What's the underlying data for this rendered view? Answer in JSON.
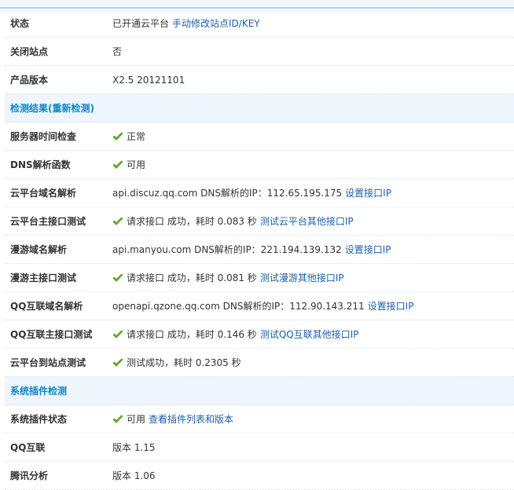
{
  "colors": {
    "link": "#1e5fa8",
    "section": "#0e86c6",
    "check": "#5cb82a"
  },
  "rows": [
    {
      "label": "状态",
      "parts": [
        {
          "t": "已开通云平台"
        },
        {
          "t": "手动修改站点ID/KEY",
          "link": true
        }
      ]
    },
    {
      "label": "关闭站点",
      "parts": [
        {
          "t": "否"
        }
      ]
    },
    {
      "label": "产品版本",
      "parts": [
        {
          "t": "X2.5 20121101"
        }
      ]
    },
    {
      "label": "检测结果(重新检测)",
      "section": true,
      "parts": []
    },
    {
      "label": "服务器时间检查",
      "check": true,
      "parts": [
        {
          "t": "正常"
        }
      ]
    },
    {
      "label": "DNS解析函数",
      "check": true,
      "parts": [
        {
          "t": "可用"
        }
      ]
    },
    {
      "label": "云平台域名解析",
      "parts": [
        {
          "t": "api.discuz.qq.com DNS解析的IP：112.65.195.175"
        },
        {
          "t": "设置接口IP",
          "link": true
        }
      ]
    },
    {
      "label": "云平台主接口测试",
      "check": true,
      "parts": [
        {
          "t": "请求接口 成功，耗时 0.083 秒"
        },
        {
          "t": "测试云平台其他接口IP",
          "link": true
        }
      ]
    },
    {
      "label": "漫游域名解析",
      "parts": [
        {
          "t": "api.manyou.com DNS解析的IP：221.194.139.132"
        },
        {
          "t": "设置接口IP",
          "link": true
        }
      ]
    },
    {
      "label": "漫游主接口测试",
      "check": true,
      "parts": [
        {
          "t": "请求接口 成功，耗时 0.081 秒"
        },
        {
          "t": "测试漫游其他接口IP",
          "link": true
        }
      ]
    },
    {
      "label": "QQ互联域名解析",
      "parts": [
        {
          "t": "openapi.qzone.qq.com DNS解析的IP：112.90.143.211"
        },
        {
          "t": "设置接口IP",
          "link": true
        }
      ]
    },
    {
      "label": "QQ互联主接口测试",
      "check": true,
      "parts": [
        {
          "t": "请求接口 成功，耗时 0.146 秒"
        },
        {
          "t": "测试QQ互联其他接口IP",
          "link": true
        }
      ]
    },
    {
      "label": "云平台到站点测试",
      "check": true,
      "parts": [
        {
          "t": "测试成功，耗时 0.2305 秒"
        }
      ]
    },
    {
      "label": "系统插件检测",
      "section": true,
      "parts": []
    },
    {
      "label": "系统插件状态",
      "check": true,
      "parts": [
        {
          "t": "可用"
        },
        {
          "t": "查看插件列表和版本",
          "link": true
        }
      ]
    },
    {
      "label": "QQ互联",
      "parts": [
        {
          "t": "版本 1.15"
        }
      ]
    },
    {
      "label": "腾讯分析",
      "parts": [
        {
          "t": "版本 1.06"
        }
      ]
    }
  ]
}
